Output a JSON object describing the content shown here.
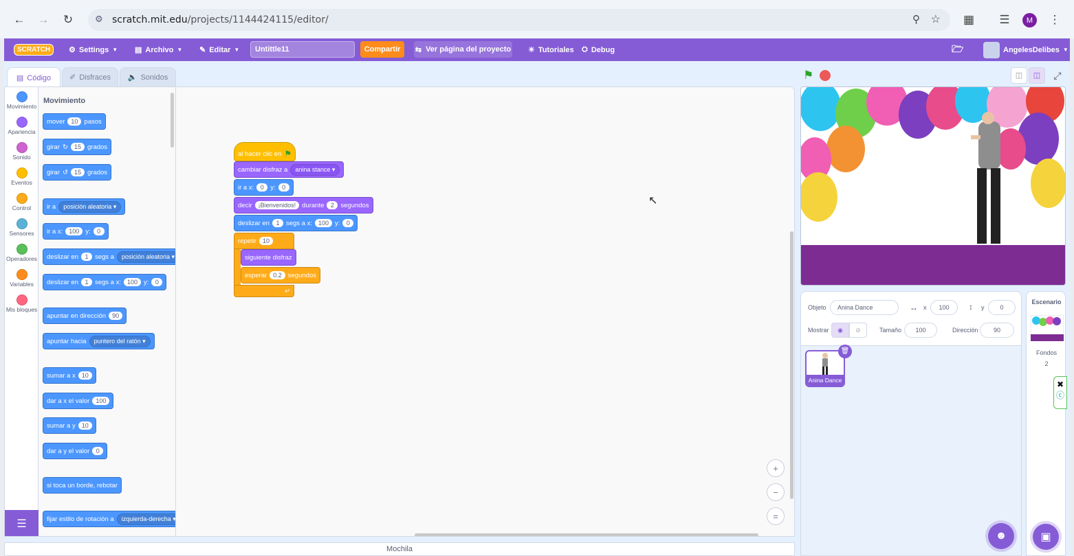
{
  "browser": {
    "url_host": "scratch.mit.edu",
    "url_path": "/projects/1144424115/editor/",
    "profile_initial": "M"
  },
  "menubar": {
    "logo": "SCRATCH",
    "settings": "Settings",
    "file": "Archivo",
    "edit": "Editar",
    "project_title": "Untittle11",
    "share": "Compartir",
    "see_project": "Ver página del proyecto",
    "tutorials": "Tutoriales",
    "debug": "Debug",
    "username": "AngelesDelibes"
  },
  "tabs": {
    "code": "Código",
    "costumes": "Disfraces",
    "sounds": "Sonidos"
  },
  "categories": [
    {
      "label": "Movimiento",
      "color": "#4c97ff"
    },
    {
      "label": "Apariencia",
      "color": "#9966ff"
    },
    {
      "label": "Sonido",
      "color": "#cf63cf"
    },
    {
      "label": "Eventos",
      "color": "#ffbf00"
    },
    {
      "label": "Control",
      "color": "#ffab19"
    },
    {
      "label": "Sensores",
      "color": "#5cb1d6"
    },
    {
      "label": "Operadores",
      "color": "#59c059"
    },
    {
      "label": "Variables",
      "color": "#ff8c1a"
    },
    {
      "label": "Mis bloques",
      "color": "#ff6680"
    }
  ],
  "palette": {
    "title": "Movimiento",
    "move": {
      "a": "mover",
      "v": "10",
      "b": "pasos"
    },
    "turn_right": {
      "a": "girar",
      "v": "15",
      "b": "grados"
    },
    "turn_left": {
      "a": "girar",
      "v": "15",
      "b": "grados"
    },
    "goto": {
      "a": "ir a",
      "dd": "posición aleatoria"
    },
    "goto_xy": {
      "a": "ir a x:",
      "x": "100",
      "y_label": "y:",
      "y": "0"
    },
    "glide_to": {
      "a": "deslizar en",
      "v": "1",
      "b": "segs a",
      "dd": "posición aleatoria"
    },
    "glide_xy": {
      "a": "deslizar en",
      "v": "1",
      "b": "segs a x:",
      "x": "100",
      "y_label": "y:",
      "y": "0"
    },
    "point_dir": {
      "a": "apuntar en dirección",
      "v": "90"
    },
    "point_towards": {
      "a": "apuntar hacia",
      "dd": "puntero del ratón"
    },
    "change_x": {
      "a": "sumar a x",
      "v": "10"
    },
    "set_x": {
      "a": "dar a x el valor",
      "v": "100"
    },
    "change_y": {
      "a": "sumar a y",
      "v": "10"
    },
    "set_y": {
      "a": "dar a y el valor",
      "v": "0"
    },
    "bounce": {
      "a": "si toca un borde, rebotar"
    },
    "rotation": {
      "a": "fijar estilo de rotación a",
      "dd": "izquierda-derecha"
    }
  },
  "script": {
    "hat": "al hacer clic en",
    "costume": {
      "a": "cambiar disfraz a",
      "dd": "anina stance"
    },
    "goto": {
      "a": "ir a x:",
      "x": "0",
      "y_label": "y:",
      "y": "0"
    },
    "say": {
      "a": "decir",
      "msg": "¡Bienvenidos!",
      "b": "durante",
      "v": "2",
      "c": "segundos"
    },
    "glide": {
      "a": "deslizar en",
      "v": "1",
      "b": "segs a x:",
      "x": "100",
      "y_label": "y:",
      "y": "0"
    },
    "repeat": {
      "a": "repetir",
      "v": "10"
    },
    "next_costume": "siguiente disfraz",
    "wait": {
      "a": "esperar",
      "v": "0.2",
      "b": "segundos"
    }
  },
  "backpack": "Mochila",
  "sprite": {
    "label_object": "Objeto",
    "name": "Anina Dance",
    "x_label": "x",
    "x": "100",
    "y_label": "y",
    "y": "0",
    "show_label": "Mostrar",
    "size_label": "Tamaño",
    "size": "100",
    "direction_label": "Dirección",
    "direction": "90",
    "card_name": "Anina Dance"
  },
  "stage_panel": {
    "title": "Escenario",
    "backdrops_label": "Fondos",
    "backdrops_count": "2"
  }
}
